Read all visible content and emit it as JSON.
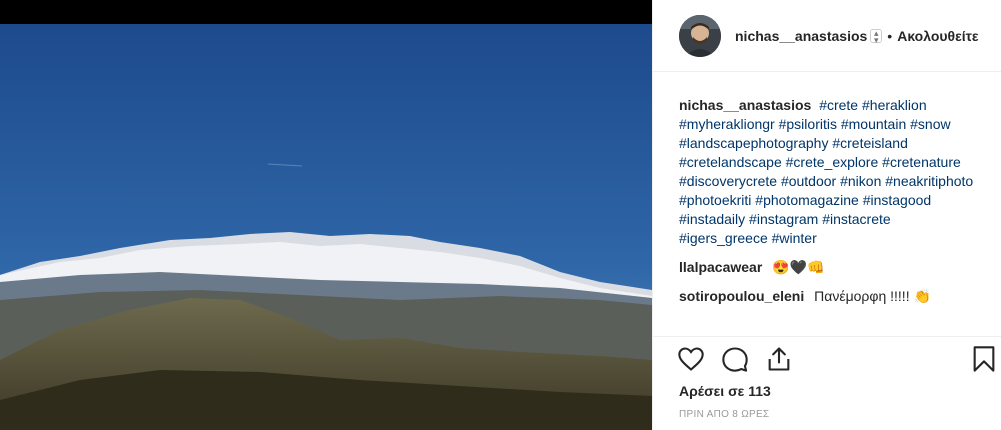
{
  "post": {
    "username": "nichas__anastasios",
    "follow_label": "Ακολουθείτε",
    "caption_user": "nichas__anastasios",
    "hashtags": [
      "#crete",
      "#heraklion",
      "#myherakliongr",
      "#psiloritis",
      "#mountain",
      "#snow",
      "#landscapephotography",
      "#creteisland",
      "#cretelandscape",
      "#crete_explore",
      "#cretenature",
      "#discoverycrete",
      "#outdoor",
      "#nikon",
      "#neakritiphoto",
      "#photoekriti",
      "#photomagazine",
      "#instagood",
      "#instadaily",
      "#instagram",
      "#instacrete",
      "#igers_greece",
      "#winter"
    ],
    "comments": [
      {
        "user": "llalpacawear",
        "text": "😍🖤👊"
      },
      {
        "user": "sotiropoulou_eleni",
        "text": "Πανέμορφη !!!!! 👏"
      }
    ],
    "likes_label": "Αρέσει σε 113",
    "time_label": "ΠΡΙΝ ΑΠΟ 8 ΩΡΕΣ"
  },
  "icons": {
    "like": "heart-icon",
    "comment": "comment-icon",
    "share": "share-icon",
    "save": "bookmark-icon"
  },
  "colors": {
    "hashtag": "#003569",
    "text": "#262626",
    "muted": "#999999",
    "border": "#efefef"
  }
}
